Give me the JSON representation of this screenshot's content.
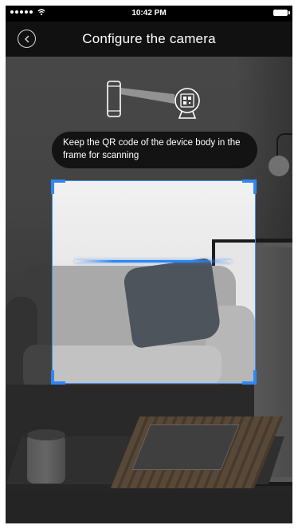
{
  "status_bar": {
    "time": "10:42 PM"
  },
  "nav": {
    "title": "Configure the camera",
    "back_icon": "chevron-left-icon"
  },
  "illustration": {
    "phone_icon": "phone-icon",
    "camera_icon": "camera-icon"
  },
  "scanner": {
    "hint": "Keep the QR code of the device body in the frame for scanning",
    "accent_color": "#2f86f2"
  }
}
